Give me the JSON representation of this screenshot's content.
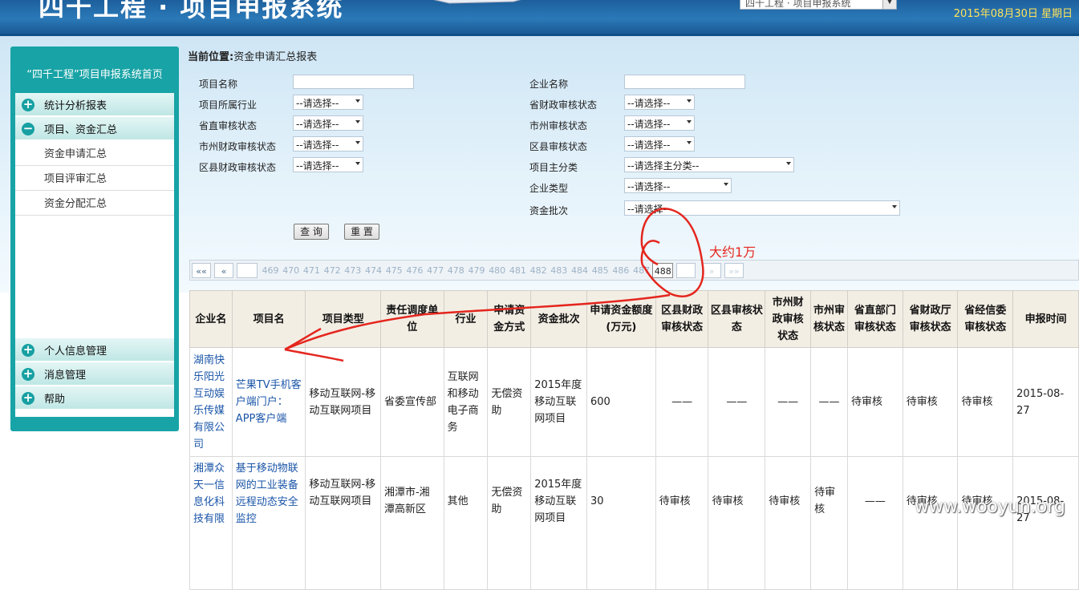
{
  "header": {
    "title": "四千工程 · 项目申报系统",
    "system_select": "四千工程 · 项目申报系统",
    "date": "2015年08月30日  星期日"
  },
  "sidebar": {
    "title": "“四千工程”项目申报系统首页",
    "menus": [
      {
        "label": "统计分析报表",
        "icon": "plus-icon"
      },
      {
        "label": "项目、资金汇总",
        "icon": "minus-icon"
      }
    ],
    "sub_items": [
      "资金申请汇总",
      "项目评审汇总",
      "资金分配汇总"
    ],
    "bottom_menus": [
      {
        "label": "个人信息管理",
        "icon": "plus-icon"
      },
      {
        "label": "消息管理",
        "icon": "plus-icon"
      },
      {
        "label": "帮助",
        "icon": "plus-icon"
      }
    ]
  },
  "breadcrumb": {
    "prefix": "当前位置:",
    "current": "资金申请汇总报表"
  },
  "form": {
    "left": {
      "project_name": "项目名称",
      "industry": "项目所属行业",
      "prov_dept": "省直审核状态",
      "city_fin": "市州财政审核状态",
      "county_fin": "区县财政审核状态"
    },
    "right": {
      "company_name": "企业名称",
      "prov_fin": "省财政审核状态",
      "city": "市州审核状态",
      "county": "区县审核状态",
      "main_cat": "项目主分类",
      "company_type": "企业类型",
      "batch": "资金批次"
    },
    "select_default": "--请选择--",
    "select_main_cat": "--请选择主分类--",
    "query_button": "查 询",
    "reset_button": "重 置"
  },
  "pager": {
    "first": "««",
    "prev": "«",
    "pages": [
      "469",
      "470",
      "471",
      "472",
      "473",
      "474",
      "475",
      "476",
      "477",
      "478",
      "479",
      "480",
      "481",
      "482",
      "483",
      "484",
      "485",
      "486",
      "487",
      "488"
    ],
    "current": "488",
    "next": "»",
    "last": "»»"
  },
  "table": {
    "headers": [
      "企业名",
      "项目名",
      "项目类型",
      "责任调度单位",
      "行业",
      "申请资金方式",
      "资金批次",
      "申请资金额度(万元)",
      "区县财政审核状态",
      "区县审核状态",
      "市州财政审核状态",
      "市州审核状态",
      "省直部门审核状态",
      "省财政厅审核状态",
      "省经信委审核状态",
      "申报时间"
    ],
    "rows": [
      [
        "湖南快乐阳光互动娱乐传媒有限公司",
        "芒果TV手机客户端门户：APP客户端",
        "移动互联网-移动互联网项目",
        "省委宣传部",
        "互联网和移动电子商务",
        "无偿资助",
        "2015年度移动互联网项目",
        "600",
        "——",
        "——",
        "——",
        "——",
        "待审核",
        "待审核",
        "待审核",
        "2015-08-27"
      ],
      [
        "湘潭众天一信息化科技有限",
        "基于移动物联网的工业装备远程动态安全监控",
        "移动互联网-移动互联网项目",
        "湘潭市-湘潭高新区",
        "其他",
        "无偿资助",
        "2015年度移动互联网项目",
        "30",
        "待审核",
        "待审核",
        "待审核",
        "待审核",
        "——",
        "待审核",
        "待审核",
        "2015-08-27"
      ]
    ]
  },
  "annotation": {
    "text": "大约1万",
    "color": "#e4261e"
  },
  "watermark": "www.wooyun.org"
}
